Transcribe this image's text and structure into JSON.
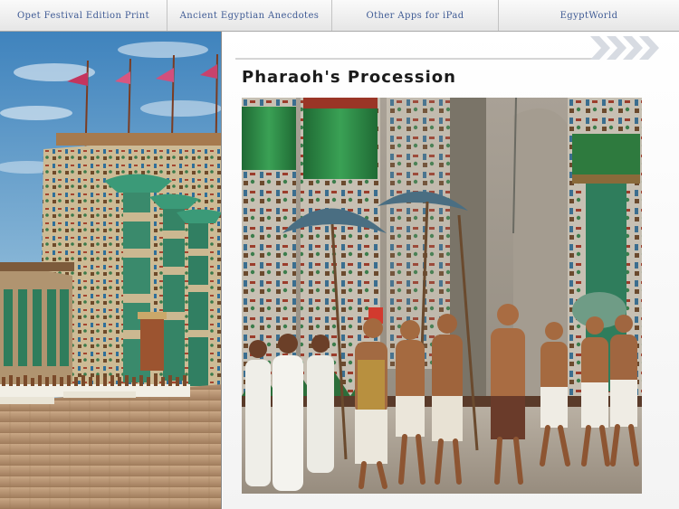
{
  "nav": {
    "tabs": [
      {
        "label": "Opet Festival Edition Print"
      },
      {
        "label": "Ancient Egyptian Anecdotes"
      },
      {
        "label": "Other Apps for iPad"
      },
      {
        "label": "EgyptWorld"
      }
    ]
  },
  "main": {
    "title": "Pharaoh's Procession",
    "pagination_icon": "chevron-arrows-icon"
  },
  "colors": {
    "nav_text": "#3e5a94",
    "title_text": "#1b1b1b"
  }
}
